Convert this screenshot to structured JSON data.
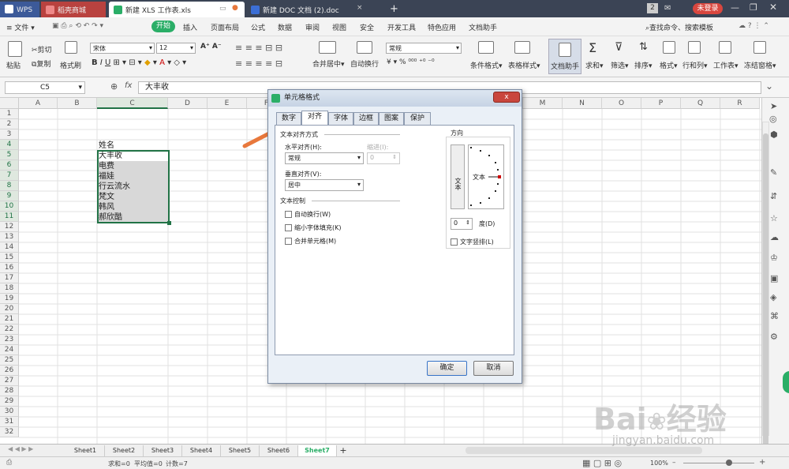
{
  "titlebar": {
    "tabs": [
      {
        "label": "WPS"
      },
      {
        "label": "稻壳商城"
      },
      {
        "label": "新建 XLS 工作表.xls"
      },
      {
        "label": "新建 DOC 文档 (2).doc"
      }
    ],
    "new_tab": "+",
    "badge": "2",
    "login_button": "未登录"
  },
  "menubar": {
    "file": "文件",
    "items": [
      "开始",
      "插入",
      "页面布局",
      "公式",
      "数据",
      "审阅",
      "视图",
      "安全",
      "开发工具",
      "特色应用",
      "文档助手"
    ],
    "search": "查找命令、搜索模板"
  },
  "toolbar": {
    "paste": "粘贴",
    "cut": "剪切",
    "copy": "复制",
    "format_painter": "格式刷",
    "font_name": "宋体",
    "font_size": "12",
    "merge_center": "合并居中",
    "wrap_text": "自动换行",
    "number_format": "常规",
    "conditional_format": "条件格式",
    "table_style": "表格样式",
    "doc_helper": "文档助手",
    "sum": "求和",
    "filter": "筛选",
    "sort": "排序",
    "format": "格式",
    "row_col": "行和列",
    "worksheet": "工作表",
    "freeze": "冻结窗格",
    "percent": "%"
  },
  "formulabar": {
    "namebox": "C5",
    "fx": "fx",
    "value": "大丰收"
  },
  "sheet": {
    "columns": [
      "A",
      "B",
      "C",
      "D",
      "E",
      "F",
      "G",
      "H",
      "I",
      "J",
      "K",
      "L",
      "M",
      "N",
      "O",
      "P",
      "Q",
      "R"
    ],
    "rows": [
      "1",
      "2",
      "3",
      "4",
      "5",
      "6",
      "7",
      "8",
      "9",
      "10",
      "11",
      "12",
      "13",
      "14",
      "15",
      "16",
      "17",
      "18",
      "19",
      "20",
      "21",
      "22",
      "23",
      "24",
      "25",
      "26",
      "27",
      "28",
      "29",
      "30",
      "31",
      "32"
    ],
    "cells": [
      "姓名",
      "大丰收",
      "电费",
      "福娃",
      "行云流水",
      "梵文",
      "韩风",
      "郝欣酷"
    ]
  },
  "sheettabs": [
    "Sheet1",
    "Sheet2",
    "Sheet3",
    "Sheet4",
    "Sheet5",
    "Sheet6",
    "Sheet7"
  ],
  "sheettab_add": "+",
  "statusbar": {
    "sum": "求和=0",
    "average": "平均值=0",
    "count": "计数=7",
    "zoom": "100%"
  },
  "dialog": {
    "title": "单元格格式",
    "close": "x",
    "tabs": [
      "数字",
      "对齐",
      "字体",
      "边框",
      "图案",
      "保护"
    ],
    "section_align": "文本对齐方式",
    "horizontal_label": "水平对齐(H):",
    "horizontal_value": "常规",
    "indent_label": "缩进(I):",
    "indent_value": "0",
    "vertical_label": "垂直对齐(V):",
    "vertical_value": "居中",
    "section_control": "文本控制",
    "wrap": "自动换行(W)",
    "shrink": "缩小字体填充(K)",
    "merge": "合并单元格(M)",
    "orientation": "方向",
    "vertical_text": "文本",
    "orient_text": "文本",
    "degrees_value": "0",
    "degrees_label": "度(D)",
    "vertical_stack": "文字竖排(L)",
    "ok": "确定",
    "cancel": "取消"
  },
  "watermark": {
    "brand": "Bai",
    "brand2": "经验",
    "url": "jingyan.baidu.com"
  },
  "colors": {
    "accent": "#2aae67",
    "selection": "#217346",
    "arrow": "#e8783c"
  }
}
